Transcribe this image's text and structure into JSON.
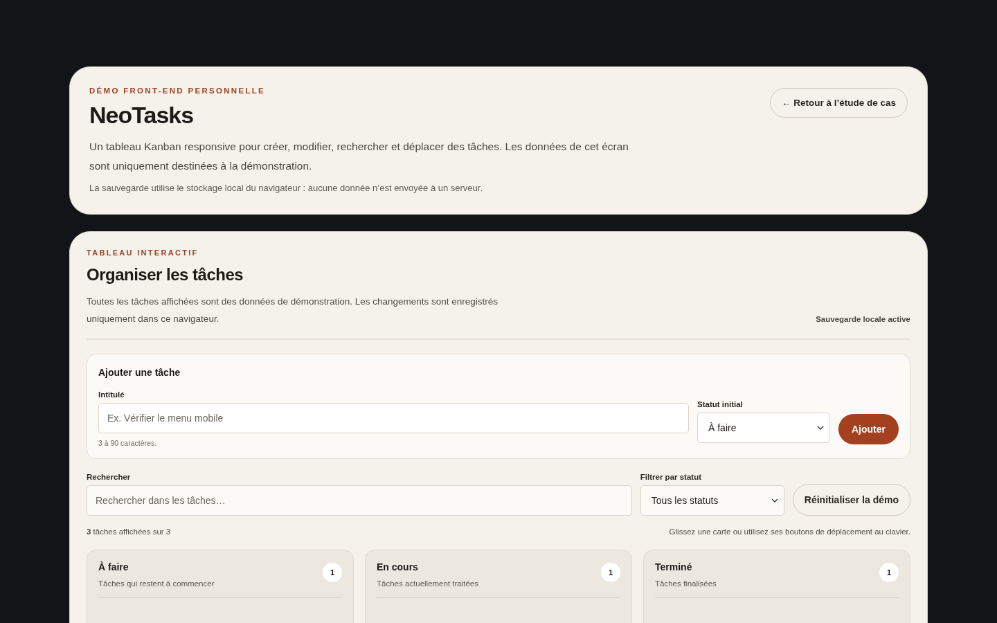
{
  "intro": {
    "eyebrow": "DÉMO FRONT-END PERSONNELLE",
    "title": "NeoTasks",
    "description": "Un tableau Kanban responsive pour créer, modifier, rechercher et déplacer des tâches. Les données de cet écran sont uniquement destinées à la démonstration.",
    "note": "La sauvegarde utilise le stockage local du navigateur : aucune donnée n’est envoyée à un serveur.",
    "back_link": "← Retour à l’étude de cas"
  },
  "board": {
    "eyebrow": "TABLEAU INTERACTIF",
    "title": "Organiser les tâches",
    "description": "Toutes les tâches affichées sont des données de démonstration. Les changements sont enregistrés uniquement dans ce navigateur.",
    "save_status": "Sauvegarde locale active",
    "add_form": {
      "title": "Ajouter une tâche",
      "title_label": "Intitulé",
      "title_placeholder": "Ex. Vérifier le menu mobile",
      "hint": "3 à 90 caractères.",
      "status_label": "Statut initial",
      "status_value": "À faire",
      "submit": "Ajouter"
    },
    "search": {
      "label": "Rechercher",
      "placeholder": "Rechercher dans les tâches…"
    },
    "filter": {
      "label": "Filtrer par statut",
      "value": "Tous les statuts"
    },
    "reset": "Réinitialiser la démo",
    "count": "**3** tâches affichées sur 3",
    "help": "Glissez une carte ou utilisez ses boutons de déplacement au clavier.",
    "columns": [
      {
        "title": "À faire",
        "subtitle": "Tâches qui restent à commencer",
        "count": "1"
      },
      {
        "title": "En cours",
        "subtitle": "Tâches actuellement traitées",
        "count": "1"
      },
      {
        "title": "Terminé",
        "subtitle": "Tâches finalisées",
        "count": "1"
      }
    ]
  }
}
